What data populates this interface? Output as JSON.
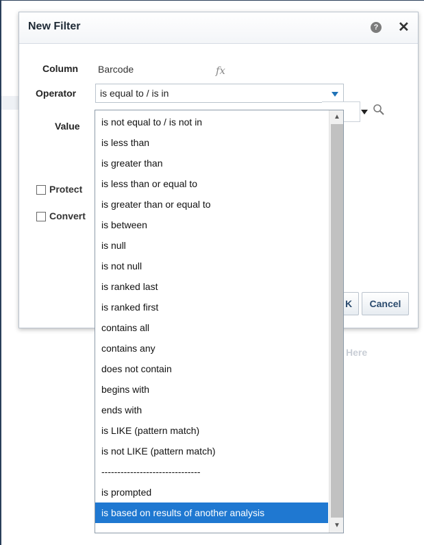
{
  "dialog": {
    "title": "New Filter",
    "help_icon": "?",
    "close_icon": "✕",
    "column_label": "Column",
    "column_value": "Barcode",
    "fx_icon": "fx",
    "operator_label": "Operator",
    "operator_selected": "is equal to / is in",
    "value_label": "Value",
    "checkbox_protect": "Protect",
    "checkbox_convert": "Convert",
    "ok_label": "K",
    "cancel_label": "Cancel"
  },
  "background": {
    "partial_text": "Here"
  },
  "dropdown": {
    "options": [
      "is not equal to / is not in",
      "is less than",
      "is greater than",
      "is less than or equal to",
      "is greater than or equal to",
      "is between",
      "is null",
      "is not null",
      "is ranked last",
      "is ranked first",
      "contains all",
      "contains any",
      "does not contain",
      "begins with",
      "ends with",
      "is LIKE (pattern match)",
      "is not LIKE (pattern match)",
      "-------------------------------",
      "is prompted",
      "is based on results of another analysis"
    ],
    "selected_index": 19
  },
  "colors": {
    "accent": "#1f78d1",
    "selected_text": "#ffffff"
  }
}
